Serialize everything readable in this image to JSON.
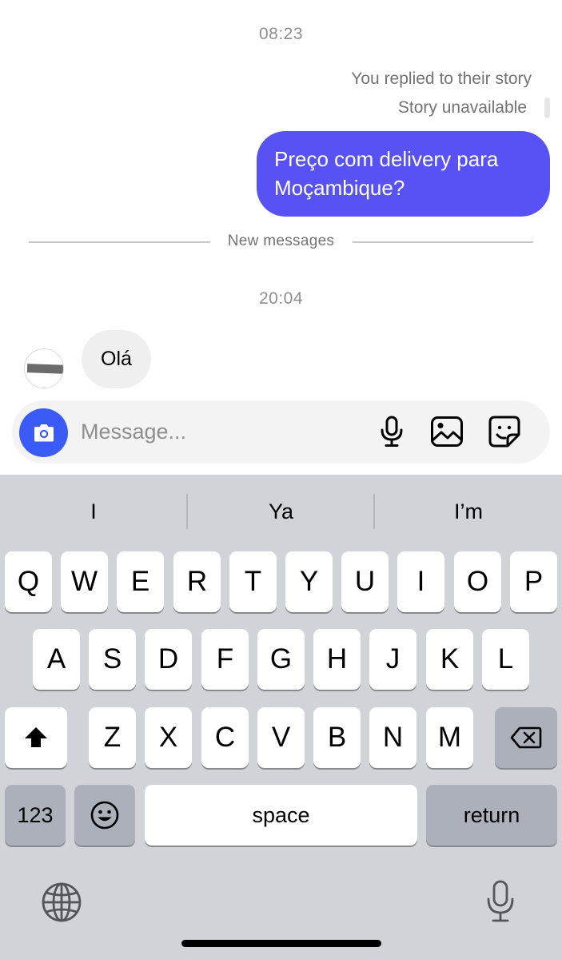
{
  "chat": {
    "timestamp_1": "08:23",
    "reply_note": "You replied to their story",
    "story_status": "Story unavailable",
    "outgoing_message": {
      "line_1": "Preço com delivery para",
      "line_2": "Moçambique?"
    },
    "divider_label": "New messages",
    "timestamp_2": "20:04",
    "incoming_message": "Olá"
  },
  "composer": {
    "placeholder": "Message..."
  },
  "keyboard": {
    "suggestions": [
      "I",
      "Ya",
      "I’m"
    ],
    "row1": [
      "Q",
      "W",
      "E",
      "R",
      "T",
      "Y",
      "U",
      "I",
      "O",
      "P"
    ],
    "row2": [
      "A",
      "S",
      "D",
      "F",
      "G",
      "H",
      "J",
      "K",
      "L"
    ],
    "row3": [
      "Z",
      "X",
      "C",
      "V",
      "B",
      "N",
      "M"
    ],
    "numbers_key": "123",
    "space_key": "space",
    "return_key": "return"
  },
  "colors": {
    "outgoing_bubble": "#5851f4",
    "camera_button": "#3b5bf6",
    "keyboard_background": "#d1d3d9"
  }
}
